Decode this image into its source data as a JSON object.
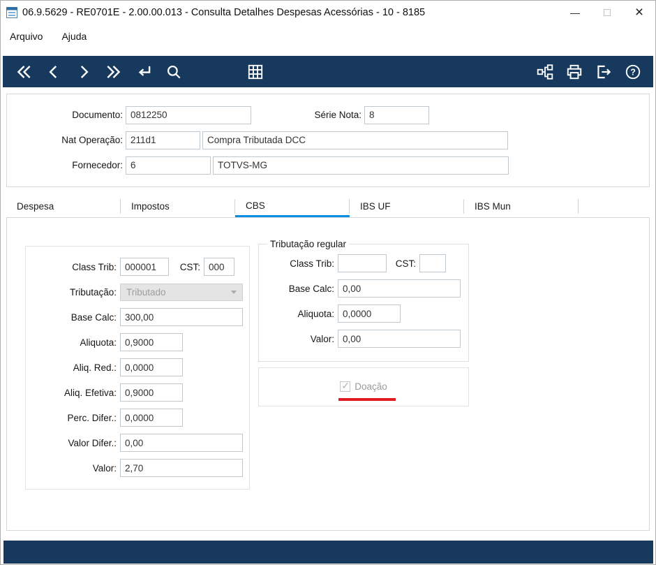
{
  "window": {
    "title": "06.9.5629 - RE0701E - 2.00.00.013 - Consulta Detalhes Despesas Acessórias - 10 - 8185",
    "controls": {
      "minimize": "—",
      "close": "×"
    }
  },
  "menu": {
    "items": [
      {
        "label": "Arquivo"
      },
      {
        "label": "Ajuda"
      }
    ]
  },
  "toolbar": {
    "icons": [
      "double-chevron-left",
      "chevron-left",
      "chevron-right",
      "double-chevron-right",
      "return",
      "search",
      "grid",
      "hierarchy",
      "printer",
      "exit",
      "help"
    ]
  },
  "header": {
    "documento_label": "Documento:",
    "documento_value": "0812250",
    "serie_label": "Série Nota:",
    "serie_value": "8",
    "natop_label": "Nat Operação:",
    "natop_value": "211d1",
    "natop_desc": "Compra Tributada DCC",
    "fornecedor_label": "Fornecedor:",
    "fornecedor_value": "6",
    "fornecedor_desc": "TOTVS-MG"
  },
  "tabs": {
    "items": [
      {
        "label": "Despesa",
        "active": false
      },
      {
        "label": "Impostos",
        "active": false
      },
      {
        "label": "CBS",
        "active": true
      },
      {
        "label": "IBS UF",
        "active": false
      },
      {
        "label": "IBS Mun",
        "active": false
      }
    ]
  },
  "cbs": {
    "left": {
      "class_trib": {
        "label": "Class Trib:",
        "value": "000001"
      },
      "cst": {
        "label": "CST:",
        "value": "000"
      },
      "tributacao": {
        "label": "Tributação:",
        "value": "Tributado"
      },
      "base_calc": {
        "label": "Base Calc:",
        "value": "300,00"
      },
      "aliquota": {
        "label": "Aliquota:",
        "value": "0,9000"
      },
      "aliq_red": {
        "label": "Aliq. Red.:",
        "value": "0,0000"
      },
      "aliq_efetiva": {
        "label": "Aliq. Efetiva:",
        "value": "0,9000"
      },
      "perc_difer": {
        "label": "Perc. Difer.:",
        "value": "0,0000"
      },
      "valor_difer": {
        "label": "Valor Difer.:",
        "value": "0,00"
      },
      "valor": {
        "label": "Valor:",
        "value": "2,70"
      }
    },
    "regular": {
      "legend": "Tributação regular",
      "class_trib": {
        "label": "Class Trib:",
        "value": ""
      },
      "cst": {
        "label": "CST:",
        "value": ""
      },
      "base_calc": {
        "label": "Base Calc:",
        "value": "0,00"
      },
      "aliquota": {
        "label": "Aliquota:",
        "value": "0,0000"
      },
      "valor": {
        "label": "Valor:",
        "value": "0,00"
      }
    },
    "doacao": {
      "label": "Doação",
      "checked": true
    }
  },
  "colors": {
    "toolbar_bg": "#17395D",
    "tab_active": "#0A8DE4",
    "annotation_red": "#E11B22"
  }
}
